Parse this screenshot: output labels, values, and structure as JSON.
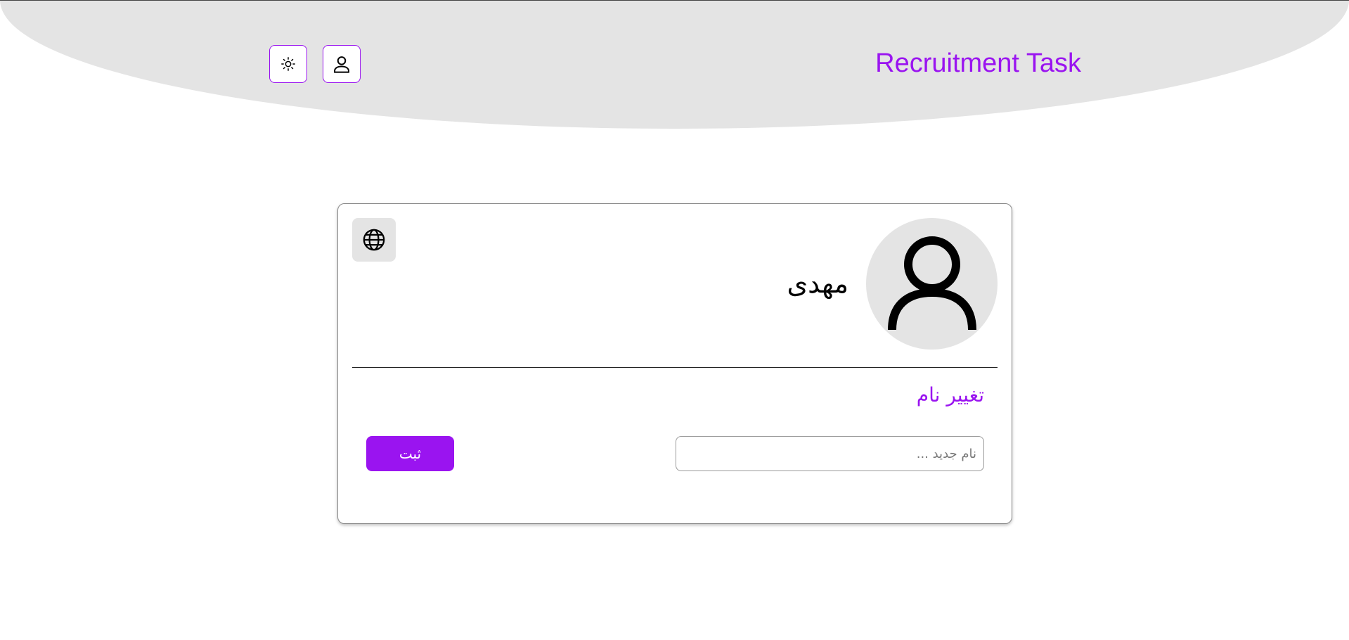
{
  "header": {
    "brand_title": "Recruitment Task",
    "theme_toggle_icon": "sun-icon",
    "profile_icon": "user-icon"
  },
  "profile_card": {
    "avatar_icon": "user-avatar-icon",
    "username": "مهدی",
    "language_icon": "globe-icon",
    "section_title": "تغییر نام",
    "name_input": {
      "value": "",
      "placeholder": "نام جدید ..."
    },
    "submit_label": "ثبت"
  },
  "colors": {
    "accent": "#9a14f0",
    "header_bg": "#e4e4e4",
    "avatar_bg": "#e4e4e4"
  }
}
